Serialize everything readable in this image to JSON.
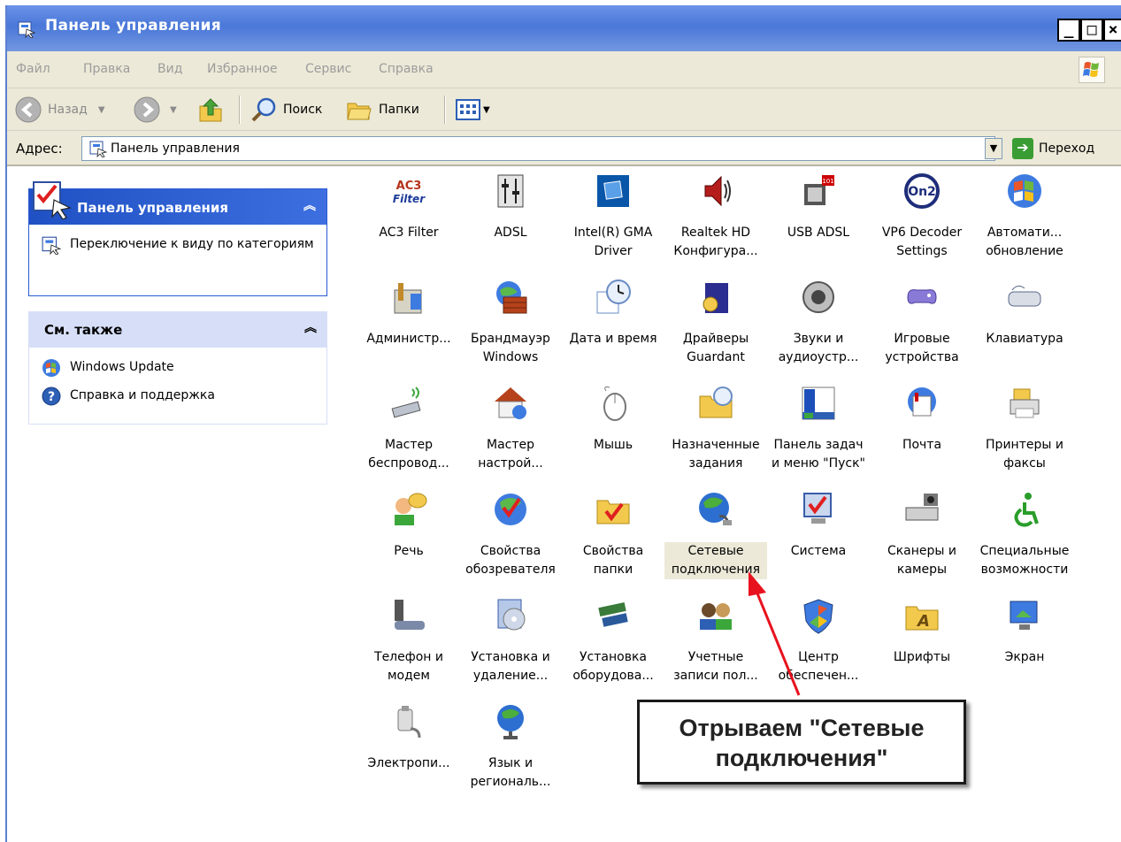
{
  "window": {
    "title": "Панель управления",
    "controls": {
      "minimize": "_",
      "maximize": "□",
      "close": "×"
    }
  },
  "menu": [
    "Файл",
    "Правка",
    "Вид",
    "Избранное",
    "Сервис",
    "Справка"
  ],
  "toolbar": {
    "back_label": "Назад",
    "search_label": "Поиск",
    "folders_label": "Папки"
  },
  "address": {
    "label": "Адрес:",
    "value": "Панель управления",
    "go_label": "Переход"
  },
  "left_panel": {
    "control_panel_box": {
      "title": "Панель управления",
      "link": "Переключение к виду по категориям"
    },
    "see_also_box": {
      "title": "См. также",
      "links": [
        "Windows Update",
        "Справка и поддержка"
      ]
    }
  },
  "items": [
    {
      "label": "AC3 Filter",
      "icon": "ac3-filter-icon"
    },
    {
      "label": "ADSL",
      "icon": "adsl-icon"
    },
    {
      "label": "Intel(R) GMA Driver",
      "icon": "intel-gma-icon"
    },
    {
      "label": "Realtek HD Конфигура...",
      "icon": "speaker-icon"
    },
    {
      "label": "USB ADSL",
      "icon": "usb-adsl-icon"
    },
    {
      "label": "VP6 Decoder Settings",
      "icon": "on2-icon"
    },
    {
      "label": "Автомати... обновление",
      "icon": "windows-update-icon"
    },
    {
      "label": "Администр...",
      "icon": "admin-tools-icon"
    },
    {
      "label": "Брандмауэр Windows",
      "icon": "firewall-icon"
    },
    {
      "label": "Дата и время",
      "icon": "clock-icon"
    },
    {
      "label": "Драйверы Guardant",
      "icon": "guardant-icon"
    },
    {
      "label": "Звуки и аудиоустр...",
      "icon": "sound-icon"
    },
    {
      "label": "Игровые устройства",
      "icon": "gamepad-icon"
    },
    {
      "label": "Клавиатура",
      "icon": "keyboard-icon"
    },
    {
      "label": "Мастер беспровод...",
      "icon": "wireless-icon"
    },
    {
      "label": "Мастер настрой...",
      "icon": "home-network-icon"
    },
    {
      "label": "Мышь",
      "icon": "mouse-icon"
    },
    {
      "label": "Назначенные задания",
      "icon": "scheduled-tasks-icon"
    },
    {
      "label": "Панель задач и меню \"Пуск\"",
      "icon": "taskbar-icon"
    },
    {
      "label": "Почта",
      "icon": "mail-icon"
    },
    {
      "label": "Принтеры и факсы",
      "icon": "printer-icon"
    },
    {
      "label": "Речь",
      "icon": "speech-icon"
    },
    {
      "label": "Свойства обозревателя",
      "icon": "internet-options-icon"
    },
    {
      "label": "Свойства папки",
      "icon": "folder-options-icon"
    },
    {
      "label": "Сетевые подключения",
      "icon": "network-connections-icon",
      "selected": true
    },
    {
      "label": "Система",
      "icon": "system-icon"
    },
    {
      "label": "Сканеры и камеры",
      "icon": "scanner-icon"
    },
    {
      "label": "Специальные возможности",
      "icon": "accessibility-icon"
    },
    {
      "label": "Телефон и модем",
      "icon": "phone-modem-icon"
    },
    {
      "label": "Установка и удаление...",
      "icon": "add-remove-icon"
    },
    {
      "label": "Установка оборудова...",
      "icon": "add-hardware-icon"
    },
    {
      "label": "Учетные записи пол...",
      "icon": "user-accounts-icon"
    },
    {
      "label": "Центр обеспечен...",
      "icon": "security-center-icon"
    },
    {
      "label": "Шрифты",
      "icon": "fonts-icon"
    },
    {
      "label": "Экран",
      "icon": "display-icon"
    },
    {
      "label": "Электропи...",
      "icon": "power-options-icon"
    },
    {
      "label": "Язык и региональ...",
      "icon": "regional-icon"
    }
  ],
  "callout": {
    "line1": "Отрываем \"Сетевые",
    "line2": "подключения\""
  },
  "colors": {
    "title_bar": "#4a78d9",
    "panel_header": "#d6dff7",
    "selected_header": "#2a5bd4",
    "arrow": "#e8121e"
  }
}
